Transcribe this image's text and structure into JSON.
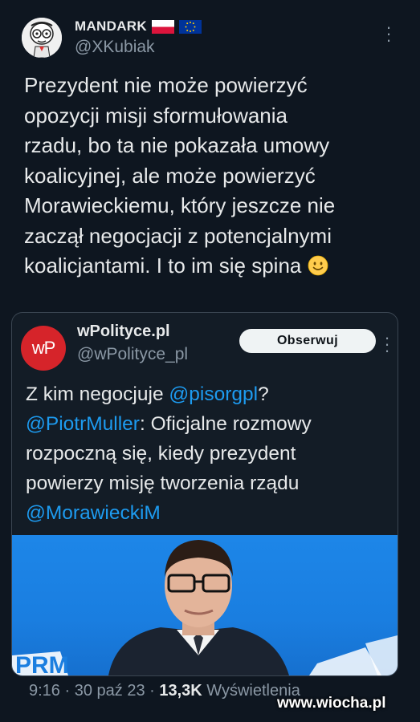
{
  "author": {
    "name": "MANDARK",
    "handle": "@XKubiak",
    "flags": [
      "poland-flag",
      "eu-flag"
    ]
  },
  "tweet": {
    "lines": [
      "Prezydent nie może powierzyć",
      "opozycji misji sformułowania",
      "rzadu, bo ta nie pokazała umowy",
      "koalicyjnej, ale może powierzyć",
      "Morawieckiemu, który jeszcze nie",
      "zaczął negocjacji z potencjalnymi",
      "koalicjantami.  I to im się spina"
    ],
    "emoji": "slightly-smiling-face"
  },
  "quote": {
    "logo_text": "wP",
    "name": "wPolityce.pl",
    "handle": "@wPolityce_pl",
    "follow_label": "Obserwuj",
    "text": {
      "l1_a": "Z kim negocjuje ",
      "l1_mention": "@pisorgpl",
      "l1_b": "?",
      "l2_mention": "@PiotrMuller",
      "l2_b": ": Oficjalne rozmowy",
      "l3": "rozpoczną się, kiedy prezydent",
      "l4": "powierzy misję tworzenia rządu",
      "l5_mention": "@MorawieckiM"
    },
    "photo_backdrop_text": "PRM"
  },
  "footer": {
    "time": "9:16",
    "sep1": " · ",
    "date": "30 paź 23",
    "sep2": " · ",
    "views_count": "13,3K",
    "views_label": " Wyświetlenia"
  },
  "watermark": "www.wiocha.pl",
  "colors": {
    "background": "#0e1620",
    "mention": "#1d9bf0",
    "wp_logo": "#d6242a",
    "photo_bg": "#1d86e8"
  }
}
